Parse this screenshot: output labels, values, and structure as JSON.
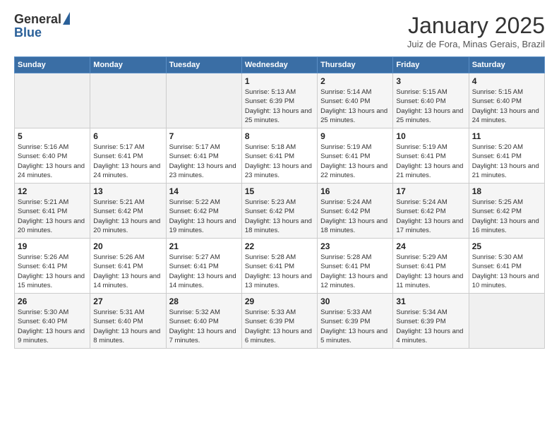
{
  "logo": {
    "general": "General",
    "blue": "Blue"
  },
  "header": {
    "month": "January 2025",
    "location": "Juiz de Fora, Minas Gerais, Brazil"
  },
  "days": [
    "Sunday",
    "Monday",
    "Tuesday",
    "Wednesday",
    "Thursday",
    "Friday",
    "Saturday"
  ],
  "weeks": [
    [
      {
        "date": "",
        "sunrise": "",
        "sunset": "",
        "daylight": ""
      },
      {
        "date": "",
        "sunrise": "",
        "sunset": "",
        "daylight": ""
      },
      {
        "date": "",
        "sunrise": "",
        "sunset": "",
        "daylight": ""
      },
      {
        "date": "1",
        "sunrise": "Sunrise: 5:13 AM",
        "sunset": "Sunset: 6:39 PM",
        "daylight": "Daylight: 13 hours and 25 minutes."
      },
      {
        "date": "2",
        "sunrise": "Sunrise: 5:14 AM",
        "sunset": "Sunset: 6:40 PM",
        "daylight": "Daylight: 13 hours and 25 minutes."
      },
      {
        "date": "3",
        "sunrise": "Sunrise: 5:15 AM",
        "sunset": "Sunset: 6:40 PM",
        "daylight": "Daylight: 13 hours and 25 minutes."
      },
      {
        "date": "4",
        "sunrise": "Sunrise: 5:15 AM",
        "sunset": "Sunset: 6:40 PM",
        "daylight": "Daylight: 13 hours and 24 minutes."
      }
    ],
    [
      {
        "date": "5",
        "sunrise": "Sunrise: 5:16 AM",
        "sunset": "Sunset: 6:40 PM",
        "daylight": "Daylight: 13 hours and 24 minutes."
      },
      {
        "date": "6",
        "sunrise": "Sunrise: 5:17 AM",
        "sunset": "Sunset: 6:41 PM",
        "daylight": "Daylight: 13 hours and 24 minutes."
      },
      {
        "date": "7",
        "sunrise": "Sunrise: 5:17 AM",
        "sunset": "Sunset: 6:41 PM",
        "daylight": "Daylight: 13 hours and 23 minutes."
      },
      {
        "date": "8",
        "sunrise": "Sunrise: 5:18 AM",
        "sunset": "Sunset: 6:41 PM",
        "daylight": "Daylight: 13 hours and 23 minutes."
      },
      {
        "date": "9",
        "sunrise": "Sunrise: 5:19 AM",
        "sunset": "Sunset: 6:41 PM",
        "daylight": "Daylight: 13 hours and 22 minutes."
      },
      {
        "date": "10",
        "sunrise": "Sunrise: 5:19 AM",
        "sunset": "Sunset: 6:41 PM",
        "daylight": "Daylight: 13 hours and 21 minutes."
      },
      {
        "date": "11",
        "sunrise": "Sunrise: 5:20 AM",
        "sunset": "Sunset: 6:41 PM",
        "daylight": "Daylight: 13 hours and 21 minutes."
      }
    ],
    [
      {
        "date": "12",
        "sunrise": "Sunrise: 5:21 AM",
        "sunset": "Sunset: 6:41 PM",
        "daylight": "Daylight: 13 hours and 20 minutes."
      },
      {
        "date": "13",
        "sunrise": "Sunrise: 5:21 AM",
        "sunset": "Sunset: 6:42 PM",
        "daylight": "Daylight: 13 hours and 20 minutes."
      },
      {
        "date": "14",
        "sunrise": "Sunrise: 5:22 AM",
        "sunset": "Sunset: 6:42 PM",
        "daylight": "Daylight: 13 hours and 19 minutes."
      },
      {
        "date": "15",
        "sunrise": "Sunrise: 5:23 AM",
        "sunset": "Sunset: 6:42 PM",
        "daylight": "Daylight: 13 hours and 18 minutes."
      },
      {
        "date": "16",
        "sunrise": "Sunrise: 5:24 AM",
        "sunset": "Sunset: 6:42 PM",
        "daylight": "Daylight: 13 hours and 18 minutes."
      },
      {
        "date": "17",
        "sunrise": "Sunrise: 5:24 AM",
        "sunset": "Sunset: 6:42 PM",
        "daylight": "Daylight: 13 hours and 17 minutes."
      },
      {
        "date": "18",
        "sunrise": "Sunrise: 5:25 AM",
        "sunset": "Sunset: 6:42 PM",
        "daylight": "Daylight: 13 hours and 16 minutes."
      }
    ],
    [
      {
        "date": "19",
        "sunrise": "Sunrise: 5:26 AM",
        "sunset": "Sunset: 6:41 PM",
        "daylight": "Daylight: 13 hours and 15 minutes."
      },
      {
        "date": "20",
        "sunrise": "Sunrise: 5:26 AM",
        "sunset": "Sunset: 6:41 PM",
        "daylight": "Daylight: 13 hours and 14 minutes."
      },
      {
        "date": "21",
        "sunrise": "Sunrise: 5:27 AM",
        "sunset": "Sunset: 6:41 PM",
        "daylight": "Daylight: 13 hours and 14 minutes."
      },
      {
        "date": "22",
        "sunrise": "Sunrise: 5:28 AM",
        "sunset": "Sunset: 6:41 PM",
        "daylight": "Daylight: 13 hours and 13 minutes."
      },
      {
        "date": "23",
        "sunrise": "Sunrise: 5:28 AM",
        "sunset": "Sunset: 6:41 PM",
        "daylight": "Daylight: 13 hours and 12 minutes."
      },
      {
        "date": "24",
        "sunrise": "Sunrise: 5:29 AM",
        "sunset": "Sunset: 6:41 PM",
        "daylight": "Daylight: 13 hours and 11 minutes."
      },
      {
        "date": "25",
        "sunrise": "Sunrise: 5:30 AM",
        "sunset": "Sunset: 6:41 PM",
        "daylight": "Daylight: 13 hours and 10 minutes."
      }
    ],
    [
      {
        "date": "26",
        "sunrise": "Sunrise: 5:30 AM",
        "sunset": "Sunset: 6:40 PM",
        "daylight": "Daylight: 13 hours and 9 minutes."
      },
      {
        "date": "27",
        "sunrise": "Sunrise: 5:31 AM",
        "sunset": "Sunset: 6:40 PM",
        "daylight": "Daylight: 13 hours and 8 minutes."
      },
      {
        "date": "28",
        "sunrise": "Sunrise: 5:32 AM",
        "sunset": "Sunset: 6:40 PM",
        "daylight": "Daylight: 13 hours and 7 minutes."
      },
      {
        "date": "29",
        "sunrise": "Sunrise: 5:33 AM",
        "sunset": "Sunset: 6:39 PM",
        "daylight": "Daylight: 13 hours and 6 minutes."
      },
      {
        "date": "30",
        "sunrise": "Sunrise: 5:33 AM",
        "sunset": "Sunset: 6:39 PM",
        "daylight": "Daylight: 13 hours and 5 minutes."
      },
      {
        "date": "31",
        "sunrise": "Sunrise: 5:34 AM",
        "sunset": "Sunset: 6:39 PM",
        "daylight": "Daylight: 13 hours and 4 minutes."
      },
      {
        "date": "",
        "sunrise": "",
        "sunset": "",
        "daylight": ""
      }
    ]
  ]
}
